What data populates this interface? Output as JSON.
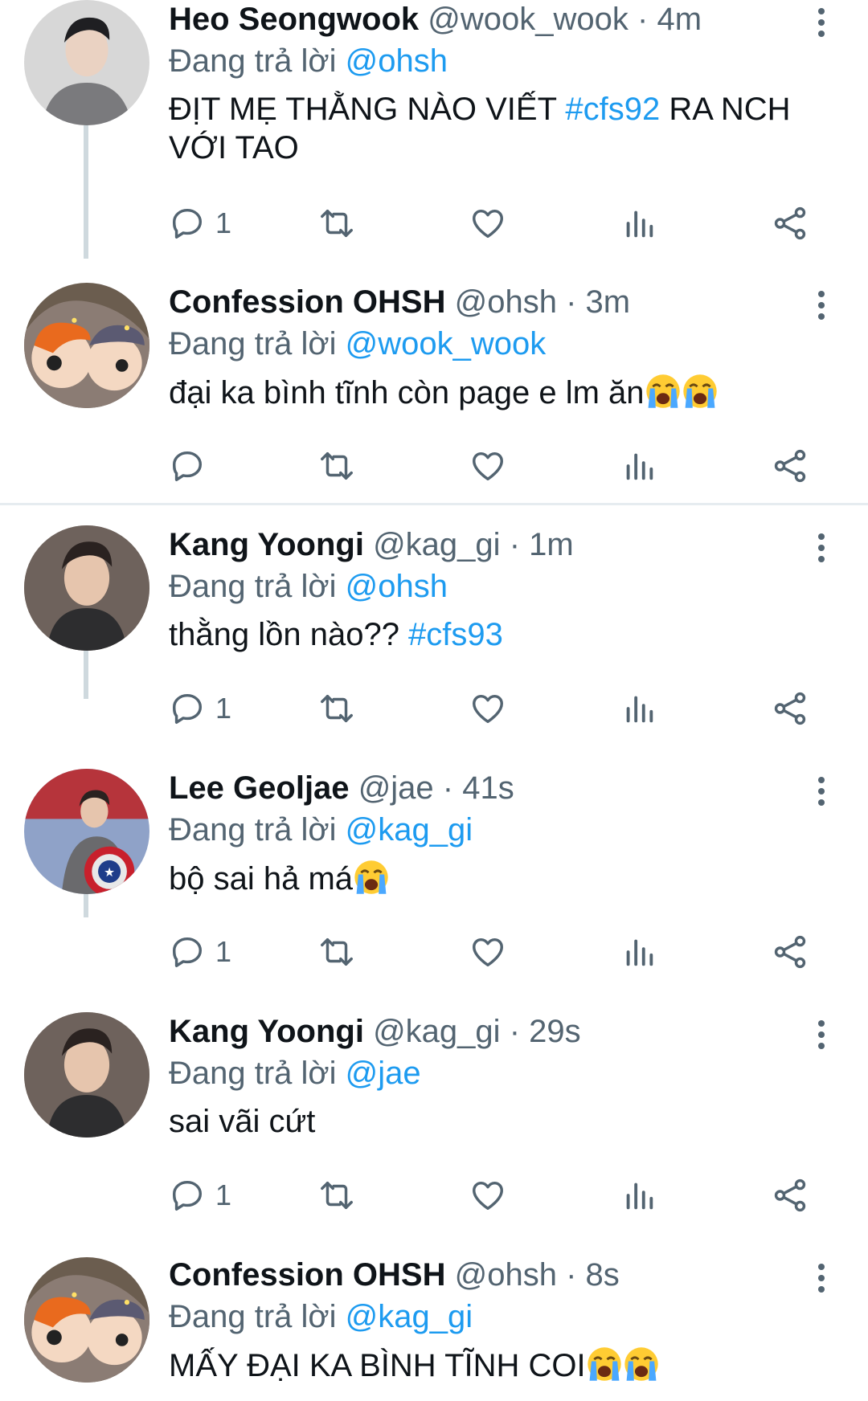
{
  "colors": {
    "accent": "#1d9bf0",
    "muted": "#536471",
    "text": "#0f1419",
    "thread": "#cfd9de"
  },
  "reply_prefix": "Đang trả lời",
  "tweets": [
    {
      "name": "Heo Seongwook",
      "handle": "@wook_wook",
      "dot": "·",
      "time": "4m",
      "reply_to": "@ohsh",
      "text_a": "ĐỊT MẸ THẰNG NÀO VIẾT ",
      "hashtag": "#cfs92",
      "text_b": " RA NCH VỚI TAO",
      "reply_count": "1",
      "avatar_icon": "profile-photo"
    },
    {
      "name": "Confession OHSH",
      "handle": "@ohsh",
      "dot": "·",
      "time": "3m",
      "reply_to": "@wook_wook",
      "text_a": "đại ka bình tĩnh còn page e lm ăn",
      "hashtag": "",
      "text_b": "",
      "emojis": [
        "loudly-crying-face",
        "loudly-crying-face"
      ],
      "reply_count": "",
      "avatar_icon": "cartoon-avatar"
    },
    {
      "name": "Kang Yoongi",
      "handle": "@kag_gi",
      "dot": "·",
      "time": "1m",
      "reply_to": "@ohsh",
      "text_a": "thằng lồn nào?? ",
      "hashtag": "#cfs93",
      "text_b": "",
      "reply_count": "1",
      "avatar_icon": "profile-photo"
    },
    {
      "name": "Lee Geoljae",
      "handle": "@jae",
      "dot": "·",
      "time": "41s",
      "reply_to": "@kag_gi",
      "text_a": "bộ sai hả má",
      "hashtag": "",
      "text_b": "",
      "emojis": [
        "loudly-crying-face"
      ],
      "reply_count": "1",
      "avatar_icon": "profile-photo-shield"
    },
    {
      "name": "Kang Yoongi",
      "handle": "@kag_gi",
      "dot": "·",
      "time": "29s",
      "reply_to": "@jae",
      "text_a": "sai vãi cứt",
      "hashtag": "",
      "text_b": "",
      "reply_count": "1",
      "avatar_icon": "profile-photo"
    },
    {
      "name": "Confession OHSH",
      "handle": "@ohsh",
      "dot": "·",
      "time": "8s",
      "reply_to": "@kag_gi",
      "text_a": "MẤY ĐẠI KA BÌNH TĨNH COI",
      "hashtag": "",
      "text_b": "",
      "emojis": [
        "loudly-crying-face",
        "loudly-crying-face"
      ],
      "reply_count": "",
      "avatar_icon": "cartoon-avatar"
    }
  ]
}
